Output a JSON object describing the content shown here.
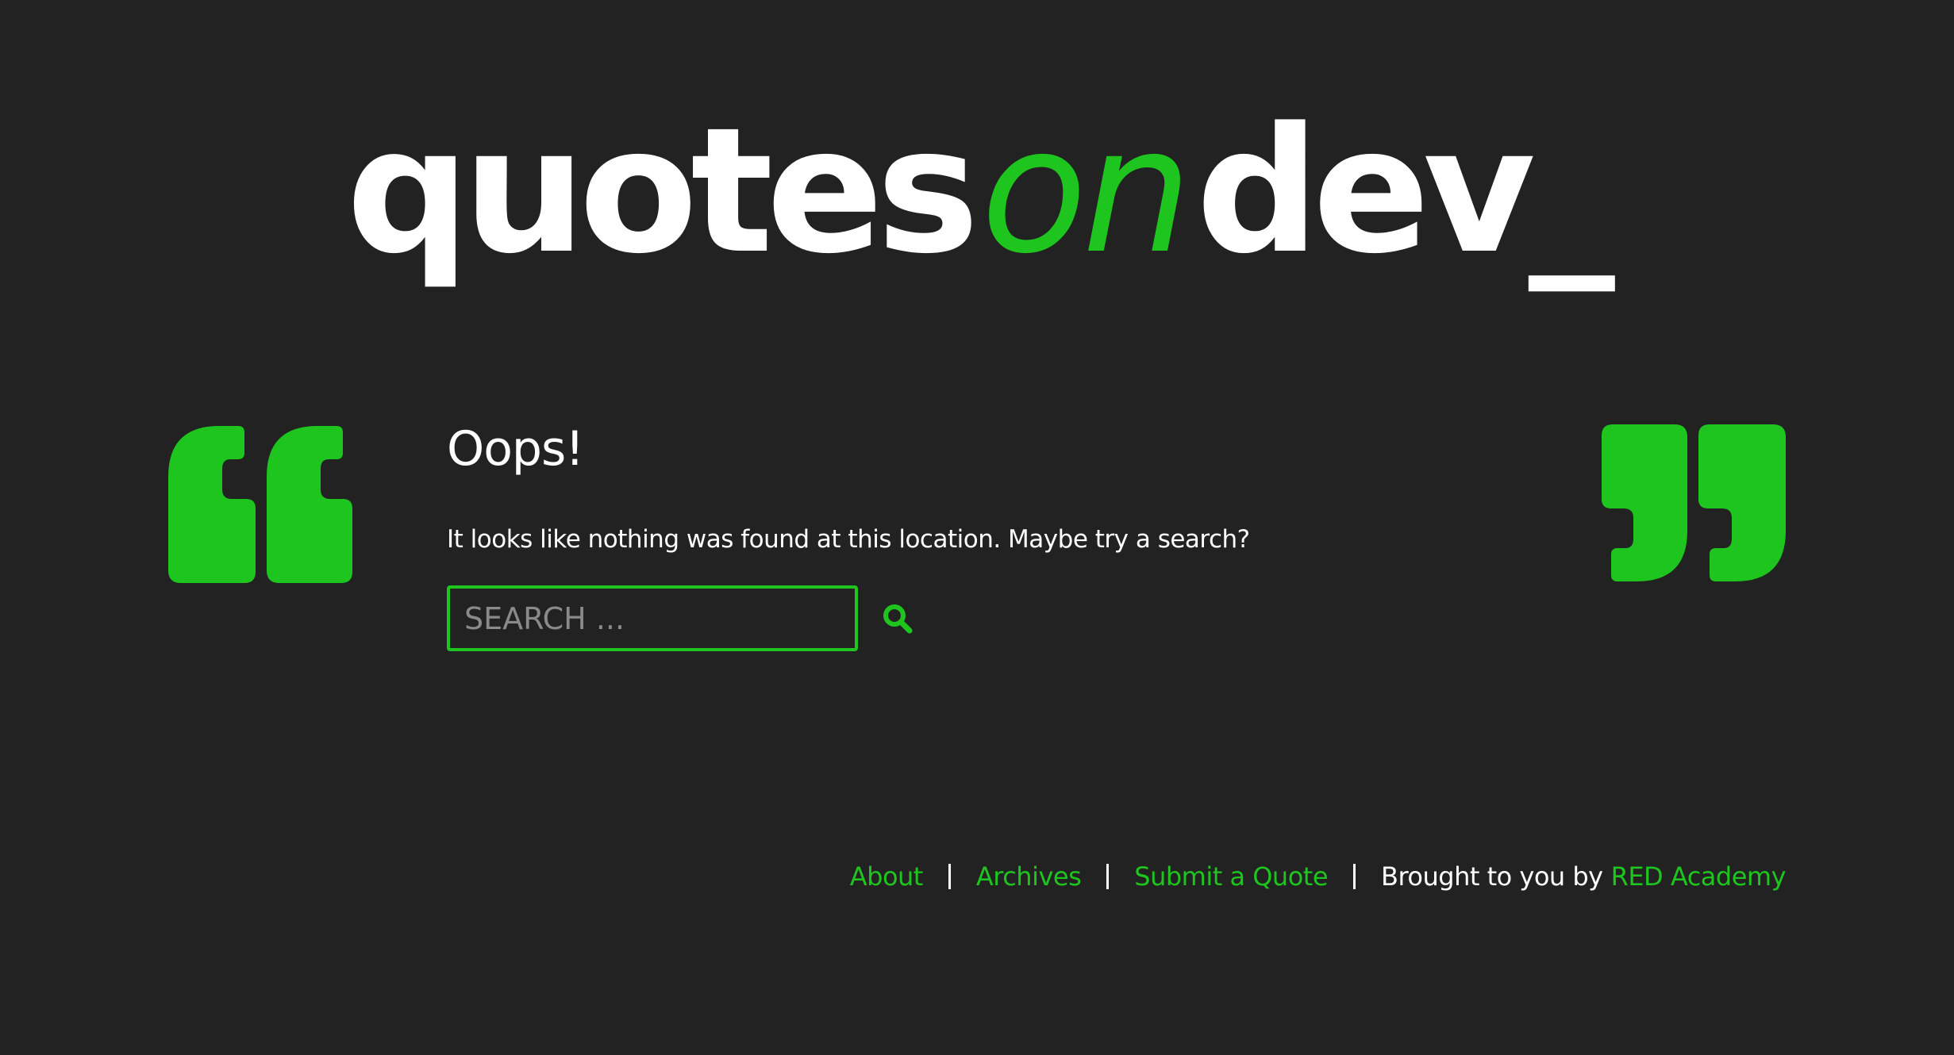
{
  "header": {
    "logo_part1": "quotes",
    "logo_part2": "on",
    "logo_part3": "dev_"
  },
  "main": {
    "title": "Oops!",
    "message": "It looks like nothing was found at this location. Maybe try a search?",
    "search": {
      "placeholder": "SEARCH ...",
      "value": "",
      "button_icon": "search-icon"
    }
  },
  "decor": {
    "left_icon": "open-quote-icon",
    "right_icon": "close-quote-icon"
  },
  "footer": {
    "links": [
      {
        "label": "About"
      },
      {
        "label": "Archives"
      },
      {
        "label": "Submit a Quote"
      }
    ],
    "credit_text": "Brought to you by",
    "credit_link": "RED Academy"
  },
  "colors": {
    "background": "#222222",
    "accent": "#1ec51e",
    "text": "#ffffff",
    "placeholder": "#8a8a8a"
  }
}
